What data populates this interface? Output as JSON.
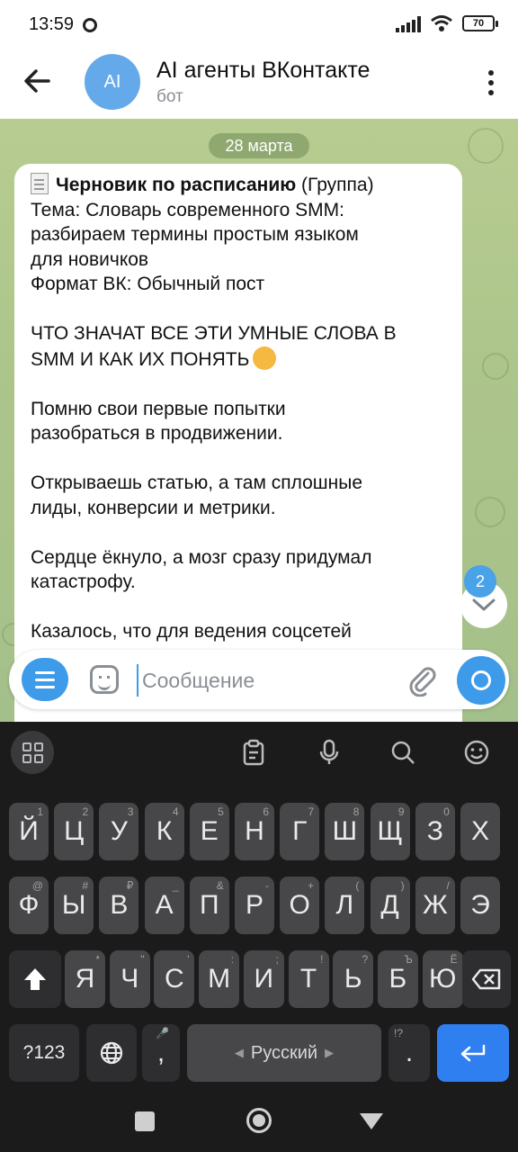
{
  "status_bar": {
    "time": "13:59",
    "battery": "70"
  },
  "header": {
    "avatar_text": "AI",
    "title": "AI агенты ВКонтакте",
    "subtitle": "бот"
  },
  "chat": {
    "date": "28 марта",
    "message": {
      "title_bold": "Черновик по расписанию",
      "title_rest": " (Группа)",
      "lines": [
        "Тема: Словарь современного SMM:",
        "разбираем термины простым языком",
        "для новичков",
        "Формат ВК: Обычный пост",
        "",
        "ЧТО ЗНАЧАТ ВСЕ ЭТИ УМНЫЕ СЛОВА В",
        "SMM И КАК ИХ ПОНЯТЬ",
        "",
        "Помню свои первые попытки",
        "разобраться в продвижении.",
        "",
        "Открываешь статью, а там сплошные",
        "лиды, конверсии и метрики.",
        "",
        "Сердце ёкнуло, а мозг сразу придумал",
        "катастрофу.",
        "",
        "Казалось, что для ведения соцсетей"
      ]
    },
    "unread_count": "2"
  },
  "input": {
    "placeholder": "Сообщение"
  },
  "keyboard": {
    "row1": [
      {
        "label": "Й",
        "hint": "1"
      },
      {
        "label": "Ц",
        "hint": "2"
      },
      {
        "label": "У",
        "hint": "3"
      },
      {
        "label": "К",
        "hint": "4"
      },
      {
        "label": "Е",
        "hint": "5"
      },
      {
        "label": "Н",
        "hint": "6"
      },
      {
        "label": "Г",
        "hint": "7"
      },
      {
        "label": "Ш",
        "hint": "8"
      },
      {
        "label": "Щ",
        "hint": "9"
      },
      {
        "label": "З",
        "hint": "0"
      },
      {
        "label": "Х",
        "hint": ""
      }
    ],
    "row2": [
      {
        "label": "Ф",
        "hint": "@"
      },
      {
        "label": "Ы",
        "hint": "#"
      },
      {
        "label": "В",
        "hint": "₽"
      },
      {
        "label": "А",
        "hint": "_"
      },
      {
        "label": "П",
        "hint": "&"
      },
      {
        "label": "Р",
        "hint": "-"
      },
      {
        "label": "О",
        "hint": "+"
      },
      {
        "label": "Л",
        "hint": "("
      },
      {
        "label": "Д",
        "hint": ")"
      },
      {
        "label": "Ж",
        "hint": "/"
      },
      {
        "label": "Э",
        "hint": ""
      }
    ],
    "row3": [
      {
        "label": "Я",
        "hint": "*"
      },
      {
        "label": "Ч",
        "hint": "\""
      },
      {
        "label": "С",
        "hint": "'"
      },
      {
        "label": "М",
        "hint": ":"
      },
      {
        "label": "И",
        "hint": ";"
      },
      {
        "label": "Т",
        "hint": "!"
      },
      {
        "label": "Ь",
        "hint": "?"
      },
      {
        "label": "Б",
        "hint": "Ъ"
      },
      {
        "label": "Ю",
        "hint": "Ё"
      }
    ],
    "symbols_label": "?123",
    "comma_label": ",",
    "space_label": "Русский",
    "period_label": ".",
    "period_hint": "!?"
  }
}
